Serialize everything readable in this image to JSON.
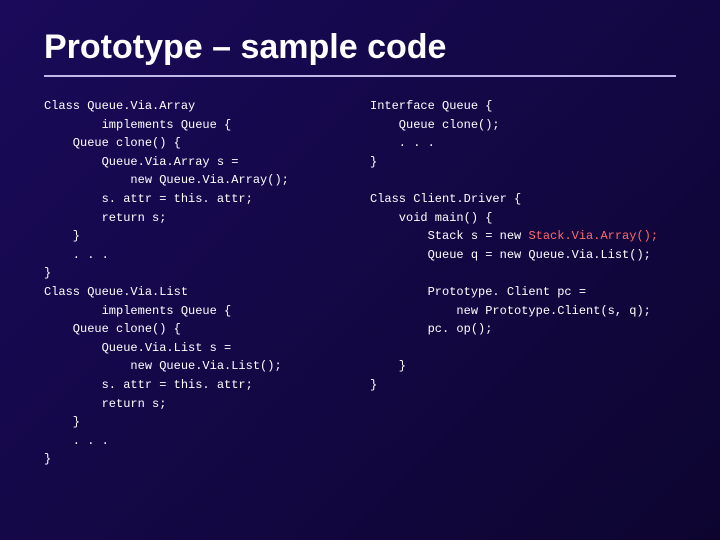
{
  "title": "Prototype – sample code",
  "code_left": "Class Queue.Via.Array\n        implements Queue {\n    Queue clone() {\n        Queue.Via.Array s =\n            new Queue.Via.Array();\n        s. attr = this. attr;\n        return s;\n    }\n    . . .\n}\nClass Queue.Via.List\n        implements Queue {\n    Queue clone() {\n        Queue.Via.List s =\n            new Queue.Via.List();\n        s. attr = this. attr;\n        return s;\n    }\n    . . .\n}",
  "code_right_pre": "Interface Queue {\n    Queue clone();\n    . . .\n}\n\nClass Client.Driver {\n    void main() {\n        Stack s = new ",
  "code_right_hl": "Stack.Via.Array();",
  "code_right_post": "\n        Queue q = new Queue.Via.List();\n\n        Prototype. Client pc =\n            new Prototype.Client(s, q);\n        pc. op();\n\n    }\n}"
}
